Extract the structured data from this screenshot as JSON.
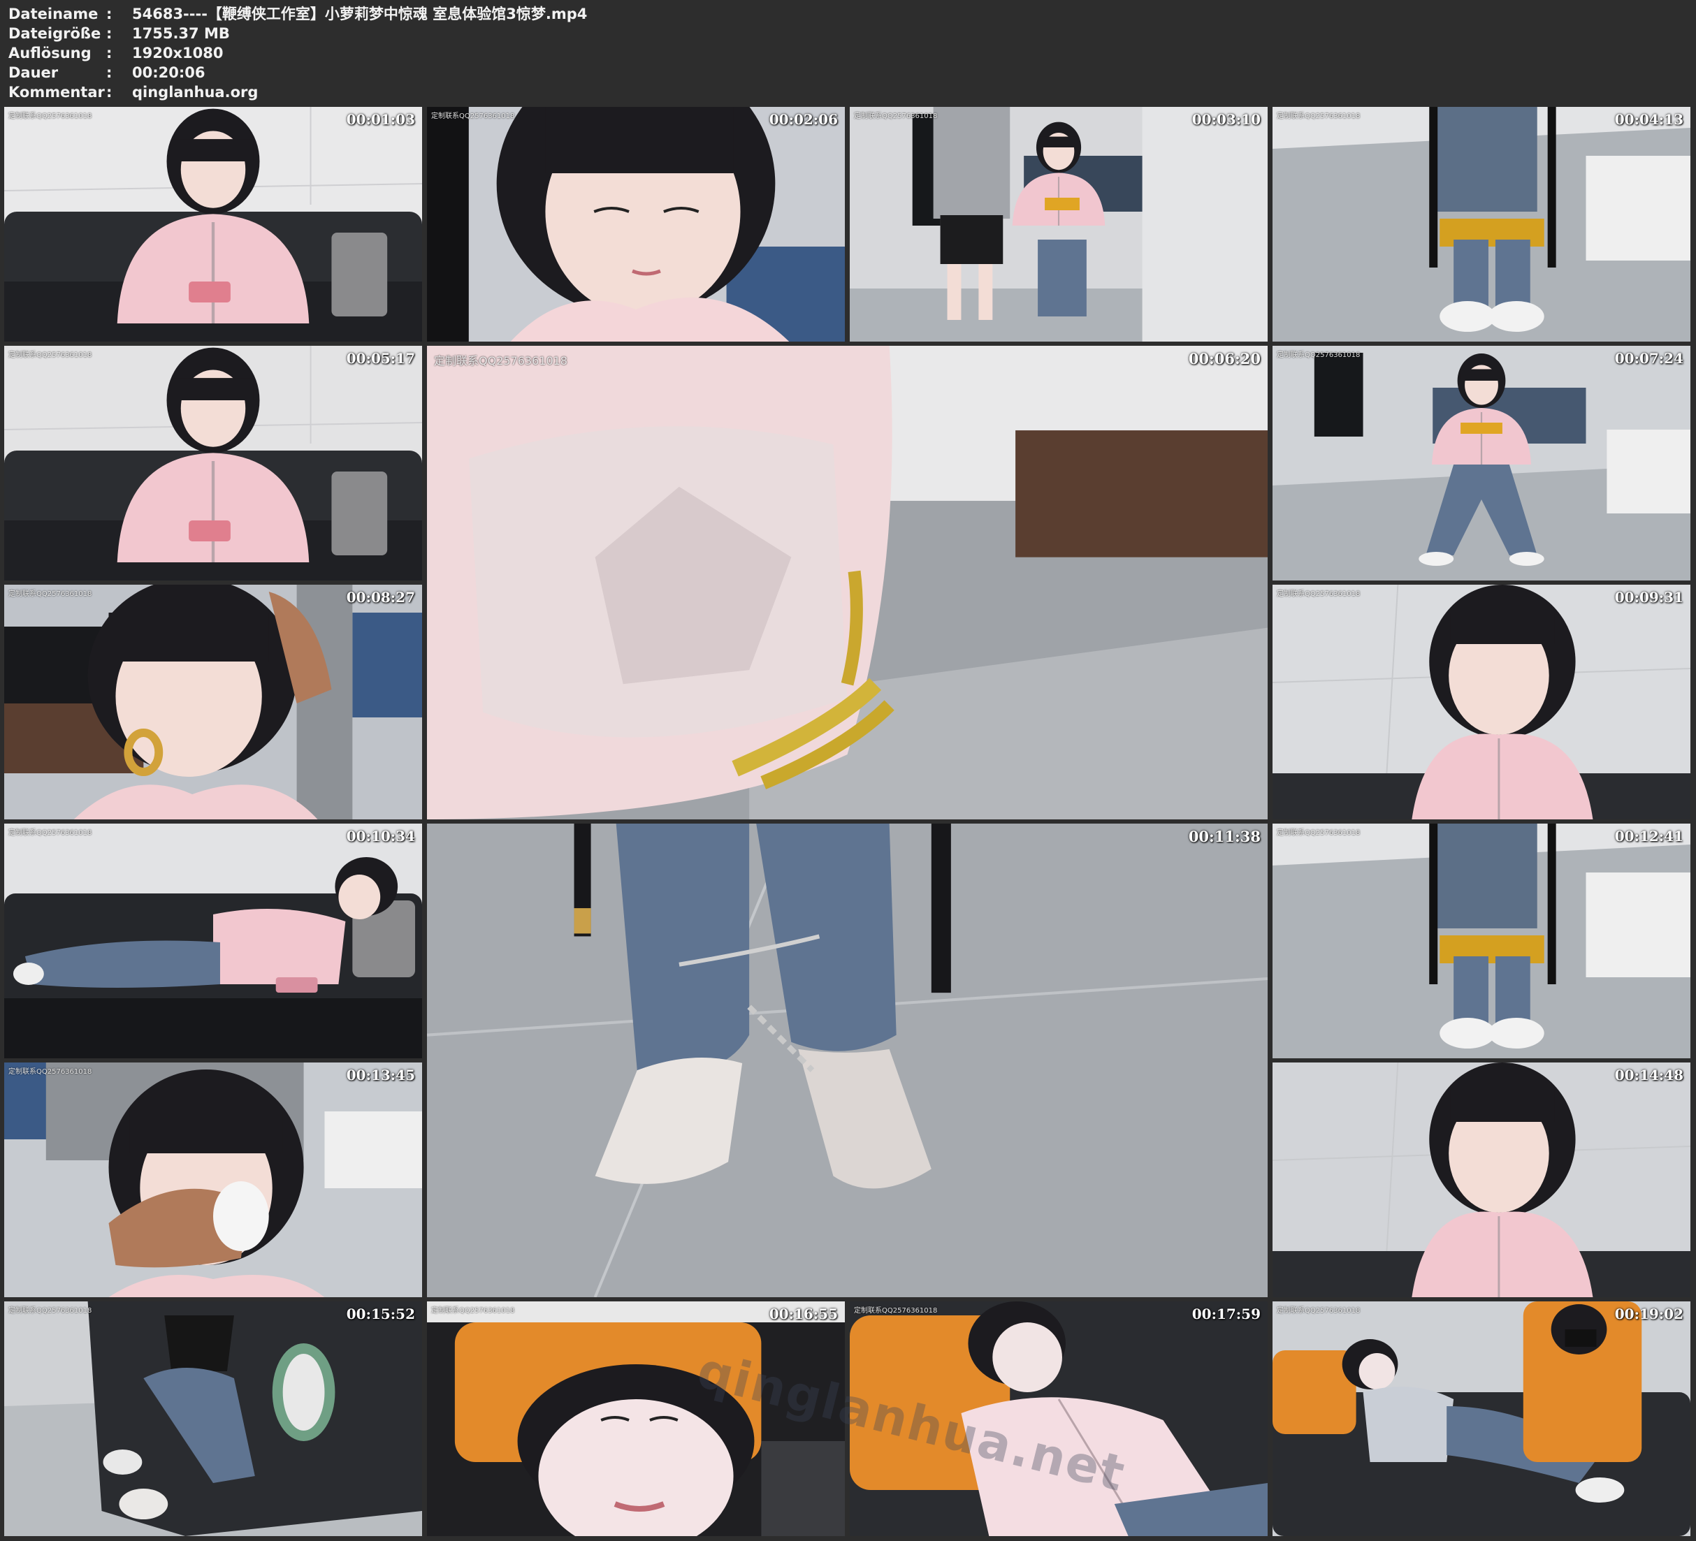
{
  "info": {
    "rows": [
      {
        "key": "Dateiname",
        "value": "54683----【鞭缚侠工作室】小萝莉梦中惊魂 室息体验馆3惊梦.mp4"
      },
      {
        "key": "Dateigröße",
        "value": "1755.37 MB"
      },
      {
        "key": "Auflösung",
        "value": "1920x1080"
      },
      {
        "key": "Dauer",
        "value": "00:20:06"
      },
      {
        "key": "Kommentar",
        "value": "qinglanhua.org"
      }
    ],
    "separator": ":"
  },
  "thumbnails": [
    {
      "timestamp": "00:01:03",
      "watermark": "定制联系QQ2576361018",
      "scene": "sofa-sitting-phone",
      "palette": [
        "#e9e9ea",
        "#2b2d31",
        "#f2c7cf"
      ]
    },
    {
      "timestamp": "00:02:06",
      "watermark": "定制联系QQ2576361018",
      "scene": "face-closeup",
      "palette": [
        "#c9ccd2",
        "#1e1e22",
        "#f4d6d9"
      ]
    },
    {
      "timestamp": "00:03:10",
      "watermark": "定制联系QQ2576361018",
      "scene": "room-chair-standing-man",
      "palette": [
        "#d7d8db",
        "#38475a",
        "#f1c6cf"
      ]
    },
    {
      "timestamp": "00:04:13",
      "watermark": "定制联系QQ2576361018",
      "scene": "chair-legs-floor",
      "palette": [
        "#c5c8cc",
        "#5c6f87",
        "#e9e9ea"
      ]
    },
    {
      "timestamp": "00:05:17",
      "watermark": "定制联系QQ2576361018",
      "scene": "sofa-sitting-phone",
      "palette": [
        "#e3e3e4",
        "#2b2d31",
        "#f2c7cf"
      ]
    },
    {
      "timestamp": "00:06:20",
      "watermark": "定制联系QQ2576361018",
      "scene": "sleeve-rope-closeup",
      "palette": [
        "#bfbcbd",
        "#4b4444",
        "#f0d9db"
      ],
      "big": true
    },
    {
      "timestamp": "00:07:24",
      "watermark": "定制联系QQ2576361018",
      "scene": "room-chair-seated",
      "palette": [
        "#d0d3d7",
        "#465870",
        "#f1c6cf"
      ]
    },
    {
      "timestamp": "00:08:27",
      "watermark": "定制联系QQ2576361018",
      "scene": "face-hands-neck",
      "palette": [
        "#bfc3c9",
        "#2a2a2e",
        "#f2cfd3"
      ]
    },
    {
      "timestamp": "00:09:31",
      "watermark": "定制联系QQ2576361018",
      "scene": "portrait-white-wall",
      "palette": [
        "#dadcdf",
        "#1f1f23",
        "#f2c7cf"
      ]
    },
    {
      "timestamp": "00:10:34",
      "watermark": "定制联系QQ2576361018",
      "scene": "sofa-lying",
      "palette": [
        "#e2e3e5",
        "#25272b",
        "#f2c7cf"
      ]
    },
    {
      "timestamp": "00:11:38",
      "watermark": "",
      "scene": "feet-shackles-floor",
      "palette": [
        "#a9adb2",
        "#475a72",
        "#e6e1de"
      ],
      "big": true
    },
    {
      "timestamp": "00:12:41",
      "watermark": "定制联系QQ2576361018",
      "scene": "chair-legs-floor",
      "palette": [
        "#c4c7cb",
        "#5c6f87",
        "#e9e9ea"
      ]
    },
    {
      "timestamp": "00:13:45",
      "watermark": "定制联系QQ2576361018",
      "scene": "hand-over-mouth",
      "palette": [
        "#c7cbd0",
        "#2a2a2e",
        "#f2cfd3"
      ]
    },
    {
      "timestamp": "00:14:48",
      "watermark": "",
      "scene": "portrait-white-wall",
      "palette": [
        "#d2d4d8",
        "#1f1f23",
        "#f2c7cf"
      ]
    },
    {
      "timestamp": "00:15:52",
      "watermark": "定制联系QQ2576361018",
      "scene": "sofa-feet-sneakers",
      "palette": [
        "#cfd1d4",
        "#2a2c30",
        "#8fb8a0"
      ]
    },
    {
      "timestamp": "00:16:55",
      "watermark": "定制联系QQ2576361018",
      "scene": "face-up-orange-pillow",
      "palette": [
        "#e38a2a",
        "#1f1f22",
        "#f4e4e6"
      ]
    },
    {
      "timestamp": "00:17:59",
      "watermark": "定制联系QQ2576361018",
      "scene": "lying-orange-pillow",
      "palette": [
        "#e38a2a",
        "#2a2c30",
        "#f4dde2"
      ]
    },
    {
      "timestamp": "00:19:02",
      "watermark": "定制联系QQ2576361018",
      "scene": "sofa-lying-man",
      "palette": [
        "#e38a2a",
        "#2a2c30",
        "#c9ced6"
      ]
    }
  ],
  "overlay_watermark": "qinglanhua.net"
}
